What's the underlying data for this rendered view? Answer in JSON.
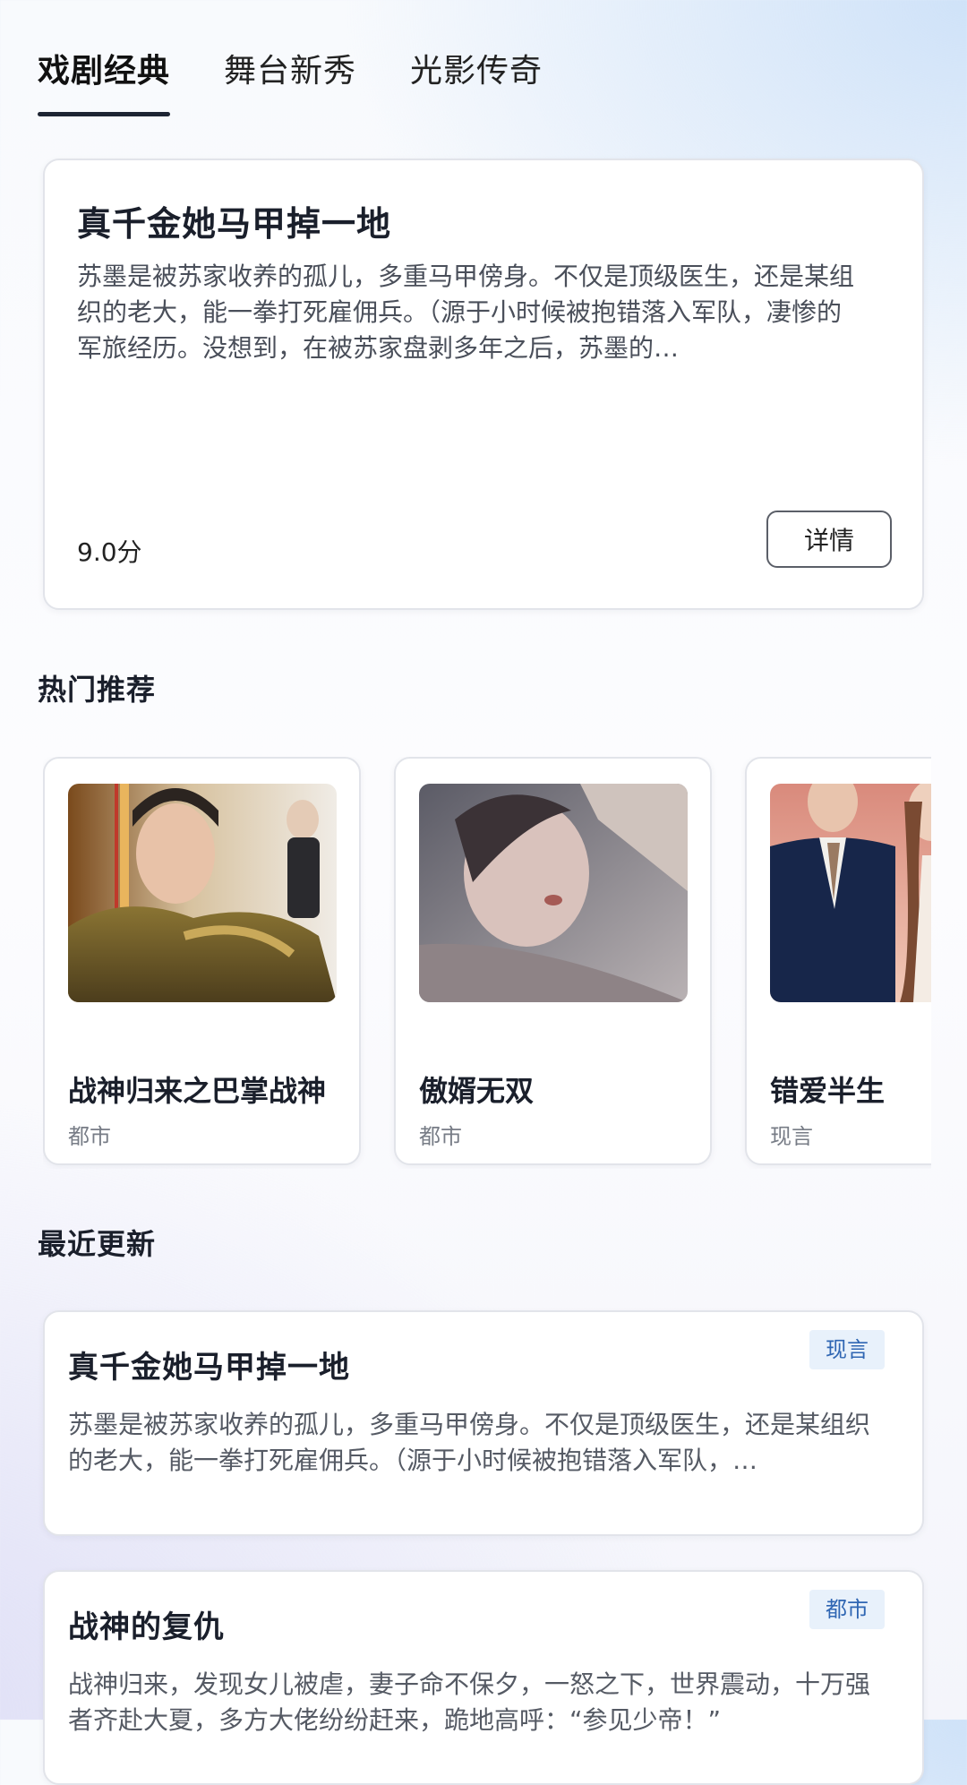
{
  "tabs": [
    {
      "label": "戏剧经典",
      "active": true
    },
    {
      "label": "舞台新秀",
      "active": false
    },
    {
      "label": "光影传奇",
      "active": false
    }
  ],
  "featured": {
    "title": "真千金她马甲掉一地",
    "description": "苏墨是被苏家收养的孤儿，多重马甲傍身。不仅是顶级医生，还是某组织的老大，能一拳打死雇佣兵。（源于小时候被抱错落入军队，凄惨的军旅经历。没想到，在被苏家盘剥多年之后，苏墨的…",
    "score": "9.0分",
    "details_label": "详情"
  },
  "hot": {
    "heading": "热门推荐",
    "items": [
      {
        "title": "战神归来之巴掌战神",
        "genre": "都市",
        "poster_icon": "poster-armored-warrior"
      },
      {
        "title": "傲婿无双",
        "genre": "都市",
        "poster_icon": "poster-romance-closeup"
      },
      {
        "title": "错爱半生",
        "genre": "现言",
        "poster_icon": "poster-couple-suits"
      }
    ]
  },
  "recent": {
    "heading": "最近更新",
    "items": [
      {
        "title": "真千金她马甲掉一地",
        "tag": "现言",
        "description": "苏墨是被苏家收养的孤儿，多重马甲傍身。不仅是顶级医生，还是某组织的老大，能一拳打死雇佣兵。（源于小时候被抱错落入军队，…"
      },
      {
        "title": "战神的复仇",
        "tag": "都市",
        "description": "战神归来，发现女儿被虐，妻子命不保夕，一怒之下，世界震动，十万强者齐赴大夏，多方大佬纷纷赶来，跪地高呼：“参见少帝！”"
      }
    ]
  },
  "colors": {
    "accent": "#1d2433",
    "tag_bg": "#e8f1fb",
    "tag_text": "#2f66b3"
  }
}
